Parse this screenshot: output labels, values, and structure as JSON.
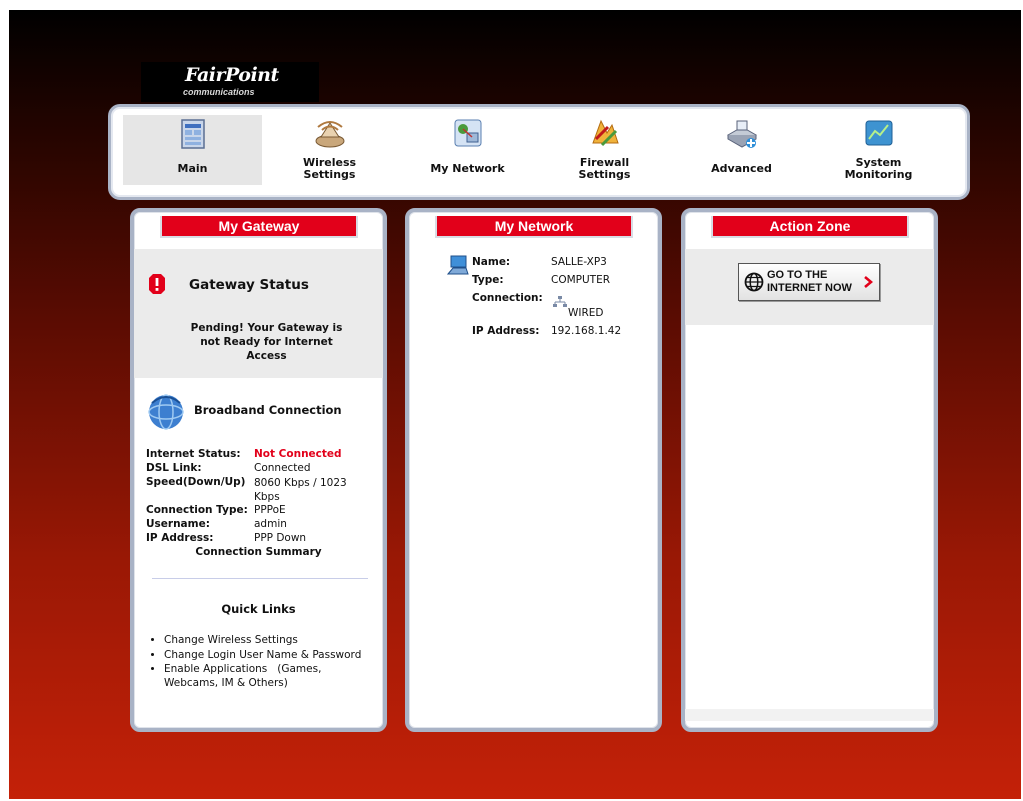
{
  "logo": {
    "line1": "FairPoint",
    "line2": "communications"
  },
  "nav": [
    {
      "label": "Main"
    },
    {
      "label": "Wireless\nSettings"
    },
    {
      "label": "My Network"
    },
    {
      "label": "Firewall\nSettings"
    },
    {
      "label": "Advanced"
    },
    {
      "label": "System\nMonitoring"
    }
  ],
  "gateway": {
    "title": "My Gateway",
    "status_title": "Gateway Status",
    "status_msg": "Pending! Your Gateway is not Ready for Internet Access",
    "broadband_title": "Broadband Connection",
    "rows": [
      {
        "label": "Internet Status:",
        "value": "Not Connected"
      },
      {
        "label": "DSL Link:",
        "value": "Connected"
      },
      {
        "label": "Speed(Down/Up)",
        "value": "8060 Kbps / 1023 Kbps"
      },
      {
        "label": "Connection Type:",
        "value": "PPPoE"
      },
      {
        "label": "Username:",
        "value": "admin"
      },
      {
        "label": "IP Address:",
        "value": "PPP Down"
      }
    ],
    "summary_link": "Connection Summary",
    "quick_links_title": "Quick Links",
    "quick_links": [
      "Change Wireless Settings",
      "Change Login User Name & Password",
      "Enable Applications   (Games, Webcams, IM & Others)"
    ]
  },
  "network": {
    "title": "My Network",
    "name_label": "Name:",
    "name": "SALLE-XP3",
    "type_label": "Type:",
    "type": "COMPUTER",
    "conn_label": "Connection:",
    "conn": "WIRED",
    "ip_label": "IP Address:",
    "ip": "192.168.1.42"
  },
  "action": {
    "title": "Action Zone",
    "button_line1": "GO TO THE",
    "button_line2": "INTERNET NOW"
  },
  "colors": {
    "accent": "#e2001a",
    "alert": "#e2001a",
    "frame": "#a9b3c6"
  }
}
